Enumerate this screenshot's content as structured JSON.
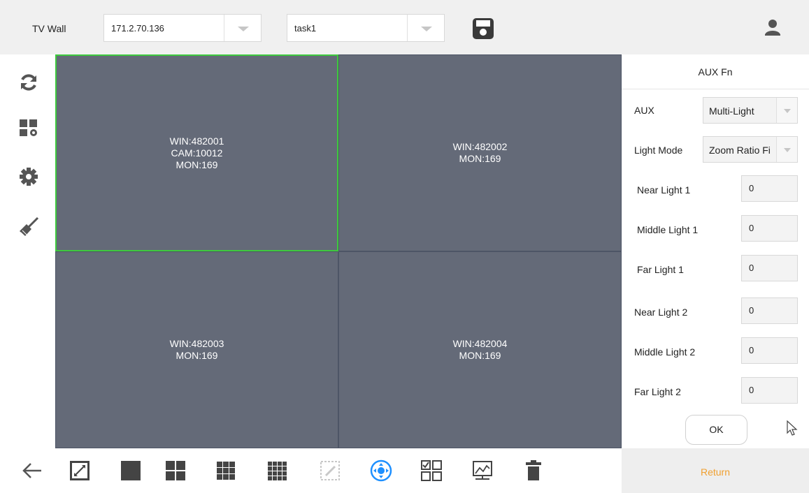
{
  "header": {
    "title": "TV Wall",
    "device_select": {
      "value": "171.2.70.136"
    },
    "task_select": {
      "value": "task1"
    }
  },
  "wall": {
    "cells": [
      {
        "lines": [
          "WIN:482001",
          "CAM:10012",
          "MON:169"
        ],
        "selected": true
      },
      {
        "lines": [
          "WIN:482002",
          "MON:169"
        ],
        "selected": false
      },
      {
        "lines": [
          "WIN:482003",
          "MON:169"
        ],
        "selected": false
      },
      {
        "lines": [
          "WIN:482004",
          "MON:169"
        ],
        "selected": false
      }
    ]
  },
  "aux_panel": {
    "title": "AUX Fn",
    "aux_label": "AUX",
    "aux_value": "Multi-Light",
    "light_mode_label": "Light Mode",
    "light_mode_value": "Zoom Ratio Fi",
    "fields": [
      {
        "label": "Near Light 1",
        "value": "0"
      },
      {
        "label": "Middle Light 1",
        "value": "0"
      },
      {
        "label": "Far Light 1",
        "value": "0"
      },
      {
        "label": "Near Light 2",
        "value": "0"
      },
      {
        "label": "Middle Light 2",
        "value": "0"
      },
      {
        "label": "Far Light 2",
        "value": "0"
      }
    ],
    "ok_label": "OK",
    "return_label": "Return"
  },
  "colors": {
    "wall_bg": "#646a78",
    "selected_border": "#3ec93e",
    "active_tool": "#1e90ff",
    "return_text": "#f0a030"
  },
  "icons": {
    "sidebar": [
      "refresh-icon",
      "layout-settings-icon",
      "gear-icon",
      "broom-icon"
    ],
    "toolbar": [
      "back-arrow-icon",
      "fullscreen-icon",
      "split-1-icon",
      "split-4-icon",
      "split-9-icon",
      "split-16-icon",
      "edit-disabled-icon",
      "ptz-control-icon",
      "custom-layout-icon",
      "monitor-chart-icon",
      "trash-icon"
    ]
  }
}
